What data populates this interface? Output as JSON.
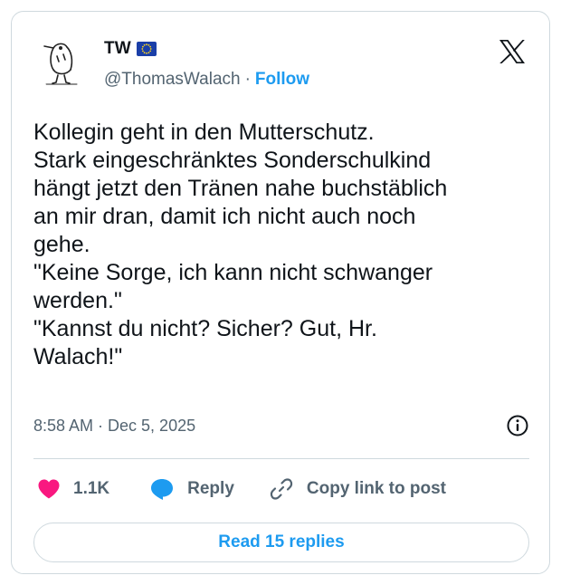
{
  "author": {
    "display_name": "TW",
    "handle": "@ThomasWalach",
    "separator": "·",
    "follow_label": "Follow",
    "avatar_icon": "kiwi-bird-sketch-avatar",
    "flag_icon": "eu-flag-icon"
  },
  "platform_icon": "x-logo-icon",
  "tweet": {
    "lines": [
      "Kollegin geht in den Mutterschutz.",
      "Stark eingeschränktes Sonderschulkind",
      "hängt jetzt den Tränen nahe buchstäblich",
      "an mir dran, damit ich nicht auch noch",
      "gehe.",
      "\"Keine Sorge, ich kann nicht schwanger",
      "werden.\"",
      "\"Kannst du nicht? Sicher? Gut, Hr.",
      "Walach!\""
    ]
  },
  "meta": {
    "timestamp": "8:58 AM · Dec 5, 2025",
    "info_icon": "info-circle-icon"
  },
  "actions": {
    "like_count": "1.1K",
    "like_icon": "heart-icon",
    "reply_label": "Reply",
    "reply_icon": "speech-bubble-icon",
    "copy_label": "Copy link to post",
    "copy_icon": "link-icon"
  },
  "read_replies_label": "Read 15 replies",
  "colors": {
    "accent": "#1d9bf0",
    "like": "#f91880",
    "text": "#0f1419",
    "muted": "#536471",
    "border": "#cfd9de"
  }
}
